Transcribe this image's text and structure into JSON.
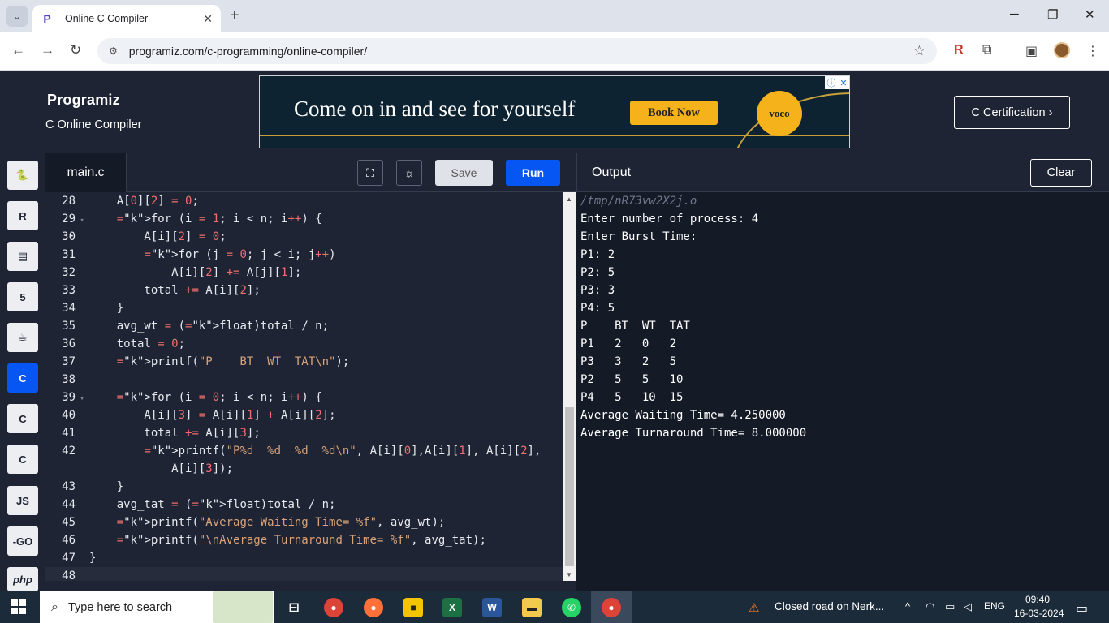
{
  "browser": {
    "tab_title": "Online C Compiler",
    "url": "programiz.com/c-programming/online-compiler/"
  },
  "site": {
    "logo": "Programiz",
    "subtitle": "C Online Compiler",
    "cert_button": "C Certification ›"
  },
  "ad": {
    "headline": "Come on in and see for yourself",
    "cta": "Book Now",
    "brand": "voco"
  },
  "languages": [
    "python-icon",
    "r-icon",
    "sql-icon",
    "html-icon",
    "java-icon",
    "c-icon",
    "cpp-icon",
    "csharp-icon",
    "js-icon",
    "go-icon",
    "php-icon"
  ],
  "lang_labels": {
    "js": "JS",
    "go": "-GO",
    "php": "php"
  },
  "editor": {
    "file_tab": "main.c",
    "save_label": "Save",
    "run_label": "Run",
    "lines": [
      {
        "n": "28",
        "fold": "",
        "code": "    A[0][2] = 0;"
      },
      {
        "n": "29",
        "fold": "▾",
        "code": "    for (i = 1; i < n; i++) {"
      },
      {
        "n": "30",
        "fold": "",
        "code": "        A[i][2] = 0;"
      },
      {
        "n": "31",
        "fold": "",
        "code": "        for (j = 0; j < i; j++)"
      },
      {
        "n": "32",
        "fold": "",
        "code": "            A[i][2] += A[j][1];"
      },
      {
        "n": "33",
        "fold": "",
        "code": "        total += A[i][2];"
      },
      {
        "n": "34",
        "fold": "",
        "code": "    }"
      },
      {
        "n": "35",
        "fold": "",
        "code": "    avg_wt = (float)total / n;"
      },
      {
        "n": "36",
        "fold": "",
        "code": "    total = 0;"
      },
      {
        "n": "37",
        "fold": "",
        "code": "    printf(\"P    BT  WT  TAT\\n\");"
      },
      {
        "n": "38",
        "fold": "",
        "code": ""
      },
      {
        "n": "39",
        "fold": "▾",
        "code": "    for (i = 0; i < n; i++) {"
      },
      {
        "n": "40",
        "fold": "",
        "code": "        A[i][3] = A[i][1] + A[i][2];"
      },
      {
        "n": "41",
        "fold": "",
        "code": "        total += A[i][3];"
      },
      {
        "n": "42",
        "fold": "",
        "code": "        printf(\"P%d  %d  %d  %d\\n\", A[i][0],A[i][1], A[i][2],"
      },
      {
        "n": "",
        "fold": "",
        "code": "            A[i][3]);"
      },
      {
        "n": "43",
        "fold": "",
        "code": "    }"
      },
      {
        "n": "44",
        "fold": "",
        "code": "    avg_tat = (float)total / n;"
      },
      {
        "n": "45",
        "fold": "",
        "code": "    printf(\"Average Waiting Time= %f\", avg_wt);"
      },
      {
        "n": "46",
        "fold": "",
        "code": "    printf(\"\\nAverage Turnaround Time= %f\", avg_tat);"
      },
      {
        "n": "47",
        "fold": "",
        "code": "}"
      },
      {
        "n": "48",
        "fold": "",
        "code": ""
      }
    ]
  },
  "output": {
    "title": "Output",
    "clear_label": "Clear",
    "path": "/tmp/nR73vw2X2j.o",
    "lines": [
      "Enter number of process: 4",
      "Enter Burst Time:",
      "P1: 2",
      "P2: 5",
      "P3: 3",
      "P4: 5",
      "P    BT  WT  TAT",
      "P1   2   0   2",
      "P3   3   2   5",
      "P2   5   5   10",
      "P4   5   10  15",
      "Average Waiting Time= 4.250000",
      "Average Turnaround Time= 8.000000"
    ]
  },
  "taskbar": {
    "search_placeholder": "Type here to search",
    "news": "Closed road on Nerk...",
    "lang": "ENG",
    "time": "09:40",
    "date": "16-03-2024"
  }
}
